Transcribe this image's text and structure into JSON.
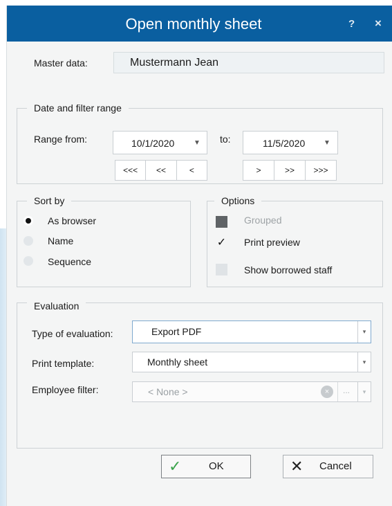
{
  "dialog": {
    "title": "Open monthly sheet",
    "help_label": "?",
    "close_label": "×"
  },
  "master": {
    "label": "Master data:",
    "value": "Mustermann Jean"
  },
  "date_filter": {
    "group_title": "Date and filter range",
    "range_from_label": "Range from:",
    "from_value": "10/1/2020",
    "to_label": "to:",
    "to_value": "11/5/2020",
    "nav_back": [
      "<<<",
      "<<",
      "<"
    ],
    "nav_forward": [
      ">",
      ">>",
      ">>>"
    ],
    "dropdown_arrow": "▼"
  },
  "sort_by": {
    "group_title": "Sort by",
    "options": [
      {
        "label": "As browser",
        "selected": true
      },
      {
        "label": "Name",
        "selected": false
      },
      {
        "label": "Sequence",
        "selected": false
      }
    ]
  },
  "options": {
    "group_title": "Options",
    "items": [
      {
        "label": "Grouped",
        "state": "indeterminate",
        "enabled": false
      },
      {
        "label": "Print preview",
        "state": "checked",
        "enabled": true
      },
      {
        "label": "Show borrowed staff",
        "state": "unchecked",
        "enabled": true
      }
    ],
    "check_glyph": "✓"
  },
  "evaluation": {
    "group_title": "Evaluation",
    "type_label": "Type of evaluation:",
    "type_value": "Export PDF",
    "template_label": "Print template:",
    "template_value": "Monthly sheet",
    "employee_label": "Employee filter:",
    "employee_placeholder": "< None >",
    "clear_glyph": "×",
    "ellipsis": "...",
    "dropdown_arrow": "▾"
  },
  "buttons": {
    "ok_label": "OK",
    "ok_icon": "✓",
    "cancel_label": "Cancel",
    "cancel_icon": "✕"
  },
  "colors": {
    "titlebar": "#0a5fa0",
    "ok_check": "#3aa34a"
  }
}
